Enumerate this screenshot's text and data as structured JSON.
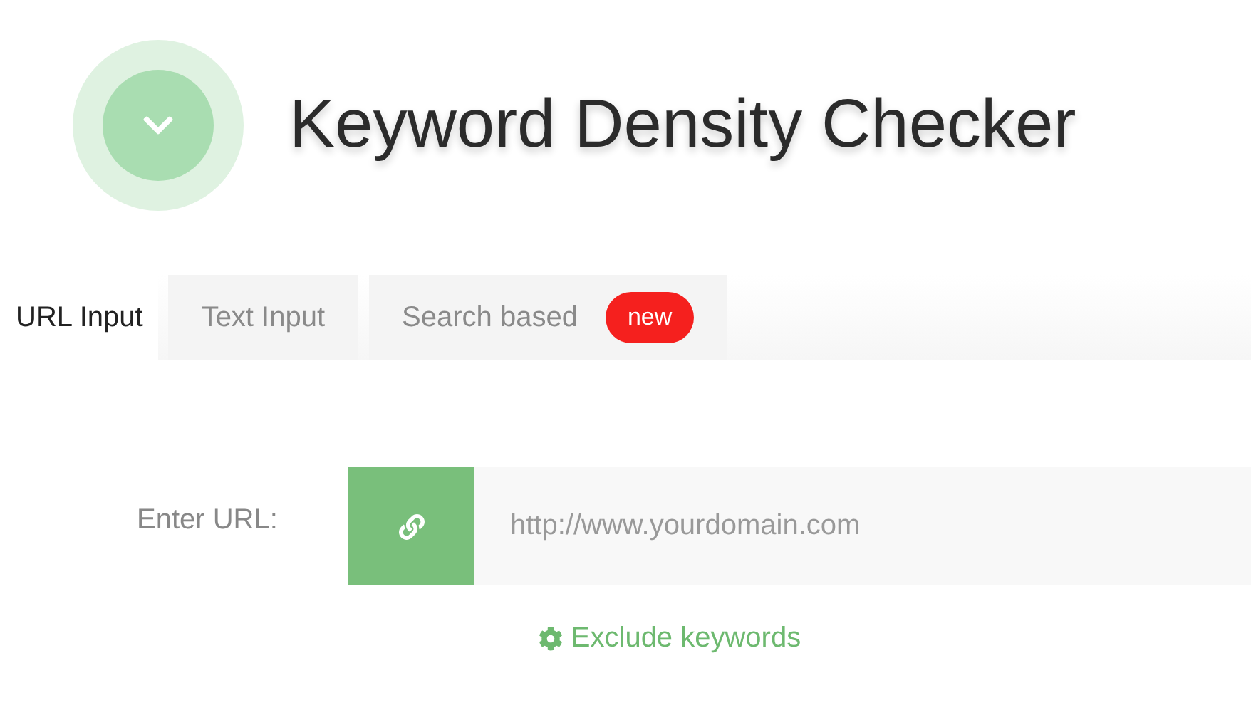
{
  "title": "Keyword Density Checker",
  "tabs": [
    {
      "label": "URL Input",
      "selected": true
    },
    {
      "label": "Text Input",
      "selected": false
    },
    {
      "label": "Search based",
      "selected": false,
      "badge": "new"
    }
  ],
  "url_field": {
    "label": "Enter URL:",
    "placeholder": "http://www.yourdomain.com"
  },
  "exclude_link": "Exclude keywords"
}
